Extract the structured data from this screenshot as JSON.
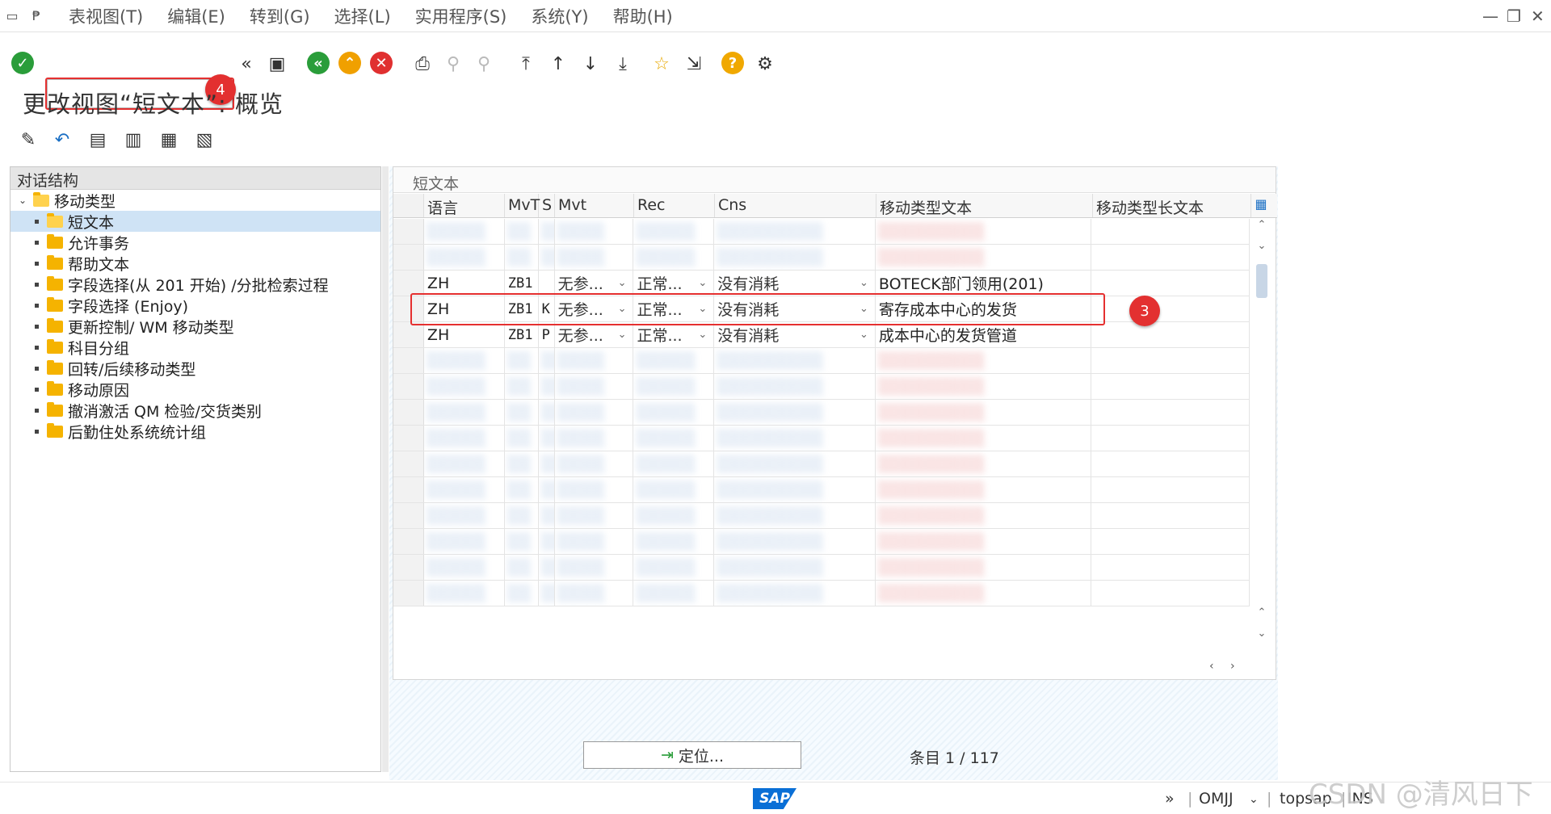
{
  "menubar": {
    "items": [
      "表视图(T)",
      "编辑(E)",
      "转到(G)",
      "选择(L)",
      "实用程序(S)",
      "系统(Y)",
      "帮助(H)"
    ]
  },
  "toolbar": {
    "command_value": "",
    "badge4": "4"
  },
  "page_title": "更改视图“短文本”: 概览",
  "left_panel": {
    "header": "对话结构",
    "tree": [
      {
        "label": "移动类型",
        "level": 0,
        "open": true
      },
      {
        "label": "短文本",
        "level": 1,
        "selected": true
      },
      {
        "label": "允许事务",
        "level": 1
      },
      {
        "label": "帮助文本",
        "level": 1
      },
      {
        "label": "字段选择(从 201 开始) /分批检索过程",
        "level": 1
      },
      {
        "label": "字段选择 (Enjoy)",
        "level": 1
      },
      {
        "label": "更新控制/ WM 移动类型",
        "level": 1
      },
      {
        "label": "科目分组",
        "level": 1
      },
      {
        "label": "回转/后续移动类型",
        "level": 1
      },
      {
        "label": "移动原因",
        "level": 1
      },
      {
        "label": "撤消激活 QM 检验/交货类别",
        "level": 1
      },
      {
        "label": "后勤住处系统统计组",
        "level": 1
      }
    ]
  },
  "grid": {
    "title": "短文本",
    "columns": [
      "语言",
      "MvT",
      "S",
      "Mvt",
      "Rec",
      "Cns",
      "移动类型文本",
      "移动类型长文本"
    ],
    "visible_rows": [
      {
        "lang": "ZH",
        "mvt": "ZB1",
        "s": "",
        "mvt_dd": "无参...",
        "rec": "正常...",
        "cns": "没有消耗",
        "text": "BOTECK部门领用(201)",
        "long": ""
      },
      {
        "lang": "ZH",
        "mvt": "ZB1",
        "s": "K",
        "mvt_dd": "无参...",
        "rec": "正常...",
        "cns": "没有消耗",
        "text": "寄存成本中心的发货",
        "long": ""
      },
      {
        "lang": "ZH",
        "mvt": "ZB1",
        "s": "P",
        "mvt_dd": "无参...",
        "rec": "正常...",
        "cns": "没有消耗",
        "text": "成本中心的发货管道",
        "long": ""
      }
    ],
    "badge3": "3"
  },
  "bottom": {
    "locate_label": "定位...",
    "entry_label": "条目 1 / 117"
  },
  "statusbar": {
    "sap": "SAP",
    "tcode": "OMJJ",
    "server": "topsap",
    "mode": "INS"
  },
  "watermark": "CSDN @清风日下",
  "colors": {
    "accent_red": "#e53030",
    "sap_blue": "#0a6fd6",
    "folder": "#f5b300"
  }
}
